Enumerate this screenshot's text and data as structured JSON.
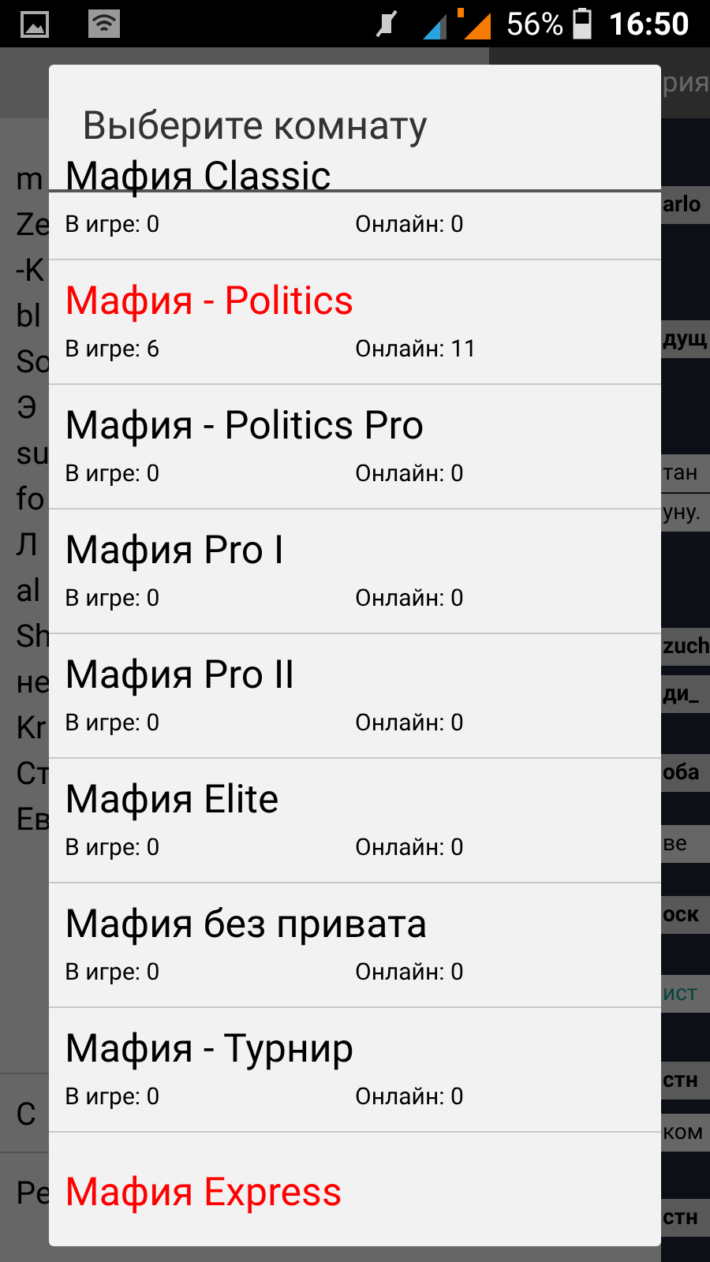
{
  "status_bar": {
    "battery": "56%",
    "time": "16:50"
  },
  "background": {
    "left_items": [
      "m",
      "Ze",
      "-K",
      "bl",
      "So",
      "Э",
      "su",
      "fo",
      "Л",
      "al",
      "Sh",
      "не",
      "Kr",
      "Ст",
      "Ев"
    ],
    "left_buttons": [
      "С",
      "Ре"
    ],
    "right_header": "рия",
    "right_items": [
      {
        "text": "arlo",
        "kind": "bold"
      },
      {
        "text": "дущ",
        "kind": "bold"
      },
      {
        "text": "тан",
        "kind": "plain"
      },
      {
        "text": "уну.",
        "kind": "plain"
      },
      {
        "text": "zuch",
        "kind": "bold"
      },
      {
        "text": "ди_",
        "kind": "bold"
      },
      {
        "text": "оба",
        "kind": "bold"
      },
      {
        "text": "ве",
        "kind": "plain"
      },
      {
        "text": "оск",
        "kind": "bold"
      },
      {
        "text": "ист",
        "kind": "link"
      },
      {
        "text": "стн",
        "kind": "bold"
      },
      {
        "text": "ком",
        "kind": "plain"
      },
      {
        "text": "стн",
        "kind": "bold"
      }
    ]
  },
  "dialog": {
    "title": "Выберите комнату",
    "rooms": [
      {
        "name": "Мафия Classic",
        "color": "#000000",
        "in_game": "В игре: 0",
        "online": "Онлайн: 0"
      },
      {
        "name": "Мафия - Politics",
        "color": "#ff0000",
        "in_game": "В игре: 6",
        "online": "Онлайн: 11"
      },
      {
        "name": "Мафия - Politics Pro",
        "color": "#000000",
        "in_game": "В игре: 0",
        "online": "Онлайн: 0"
      },
      {
        "name": "Мафия Pro I",
        "color": "#000000",
        "in_game": "В игре: 0",
        "online": "Онлайн: 0"
      },
      {
        "name": "Мафия Pro II",
        "color": "#000000",
        "in_game": "В игре: 0",
        "online": "Онлайн: 0"
      },
      {
        "name": "Мафия Elite",
        "color": "#000000",
        "in_game": "В игре: 0",
        "online": "Онлайн: 0"
      },
      {
        "name": "Мафия без привата",
        "color": "#000000",
        "in_game": "В игре: 0",
        "online": "Онлайн: 0"
      },
      {
        "name": "Мафия - Турнир",
        "color": "#000000",
        "in_game": "В игре: 0",
        "online": "Онлайн: 0"
      },
      {
        "name": "Мафия Express",
        "color": "#ff0000"
      }
    ]
  }
}
